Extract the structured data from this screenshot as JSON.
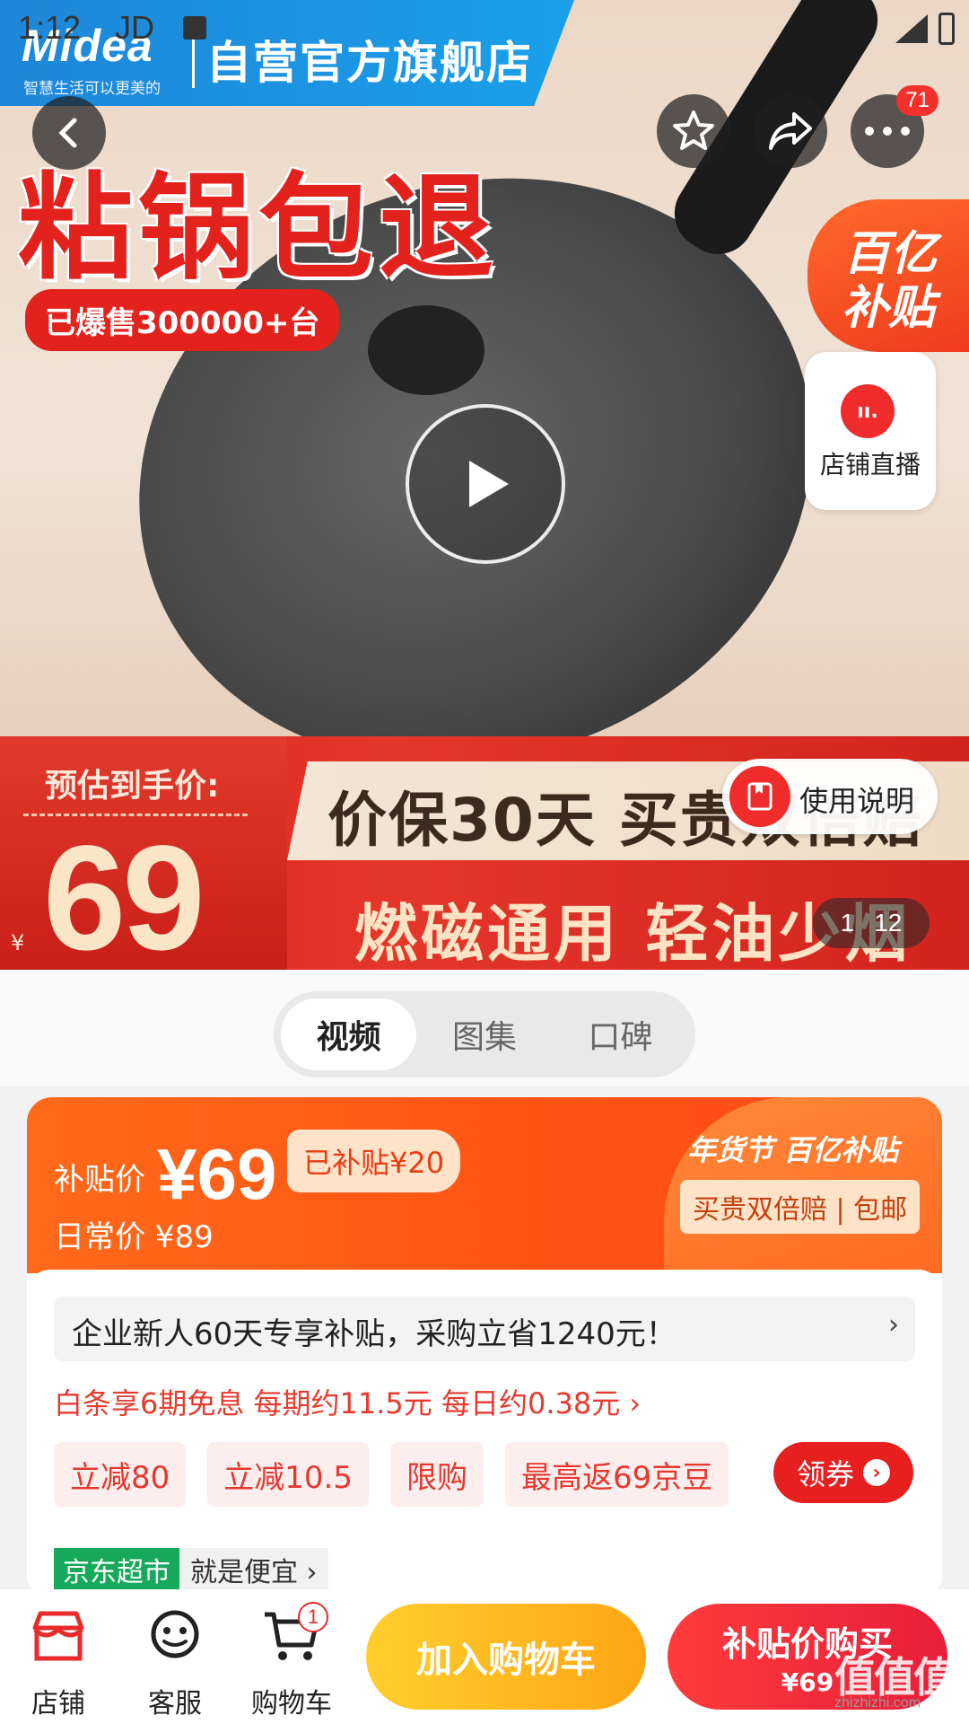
{
  "status_bar": {
    "time": "1:12",
    "carrier": "JD"
  },
  "brand": {
    "logo": "Midea",
    "tagline": "智慧生活可以更美的",
    "store": "自营官方旗舰店"
  },
  "hero": {
    "headline": "粘锅包退",
    "sold": "已爆售300000+台",
    "badge_line1": "百亿",
    "badge_line2": "补贴",
    "live_label": "店铺直播",
    "live_icon_text": "ıı.",
    "estimate_label": "预估到手价:",
    "currency": "¥",
    "estimate_price": "69",
    "guarantee": "价保30天 买贵双倍赔",
    "features": "燃磁通用 轻油少烟",
    "manual_label": "使用说明",
    "page_current": "1",
    "page_total": "12",
    "more_badge": "71"
  },
  "tabs": [
    {
      "label": "视频",
      "active": true
    },
    {
      "label": "图集",
      "active": false
    },
    {
      "label": "口碑",
      "active": false
    }
  ],
  "subsidy": {
    "label": "补贴价",
    "price": "¥69",
    "subsidized": "已补贴¥20",
    "daily": "日常价 ¥89",
    "festival": "年货节 百亿补贴",
    "guarantee_tag": "买贵双倍赔 | 包邮"
  },
  "promo": {
    "enterprise": "企业新人60天专享补贴，采购立省1240元！",
    "baitiao": "白条享6期免息 每期约11.5元 每日约0.38元 ›",
    "coupons": [
      "立减80",
      "立减10.5",
      "限购",
      "最高返69京豆"
    ],
    "get_coupon": "领券"
  },
  "market": {
    "tag": "京东超市",
    "slogan": "就是便宜 ›"
  },
  "bottom_nav": {
    "store": "店铺",
    "service": "客服",
    "cart": "购物车",
    "cart_count": "1",
    "add_cart": "加入购物车",
    "buy_label": "补贴价购买",
    "buy_price": "¥69"
  },
  "watermark": {
    "text": "值值值",
    "url": "zhizhizhi.com"
  },
  "colors": {
    "jd_red": "#e81f1f",
    "subsidy_orange": "#ff5314",
    "midea_blue": "#1e86d8",
    "market_green": "#17a95b"
  }
}
